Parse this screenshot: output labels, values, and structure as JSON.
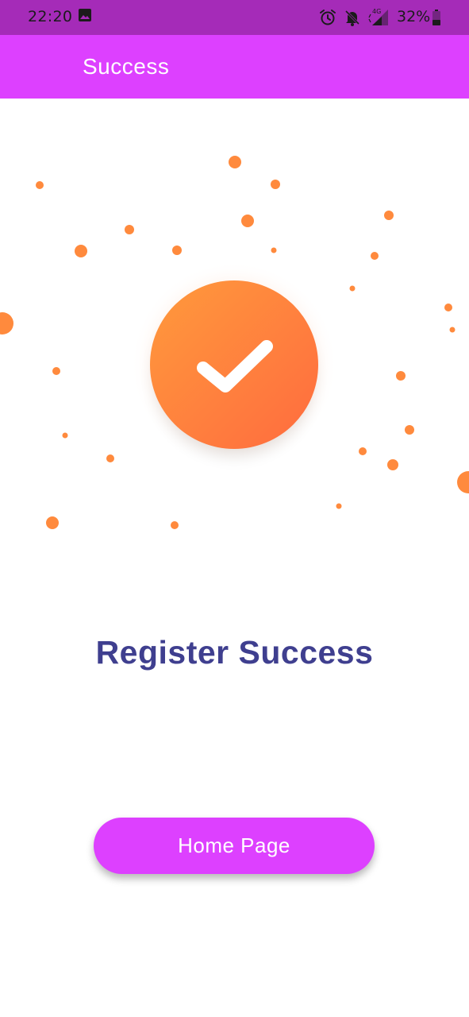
{
  "status_bar": {
    "time": "22:20",
    "battery_percent": "32%",
    "network_label": "4G",
    "icons": [
      "image-icon",
      "alarm-icon",
      "bell-off-icon",
      "signal-icon",
      "battery-icon"
    ]
  },
  "app_bar": {
    "title": "Success"
  },
  "main": {
    "title": "Register Success",
    "home_button_label": "Home Page"
  },
  "colors": {
    "status_bar": "#a52bb8",
    "app_bar": "#dd40ff",
    "accent_orange": "#ff8a3d",
    "title_text": "#3f3f8f",
    "button": "#dd40ff"
  }
}
